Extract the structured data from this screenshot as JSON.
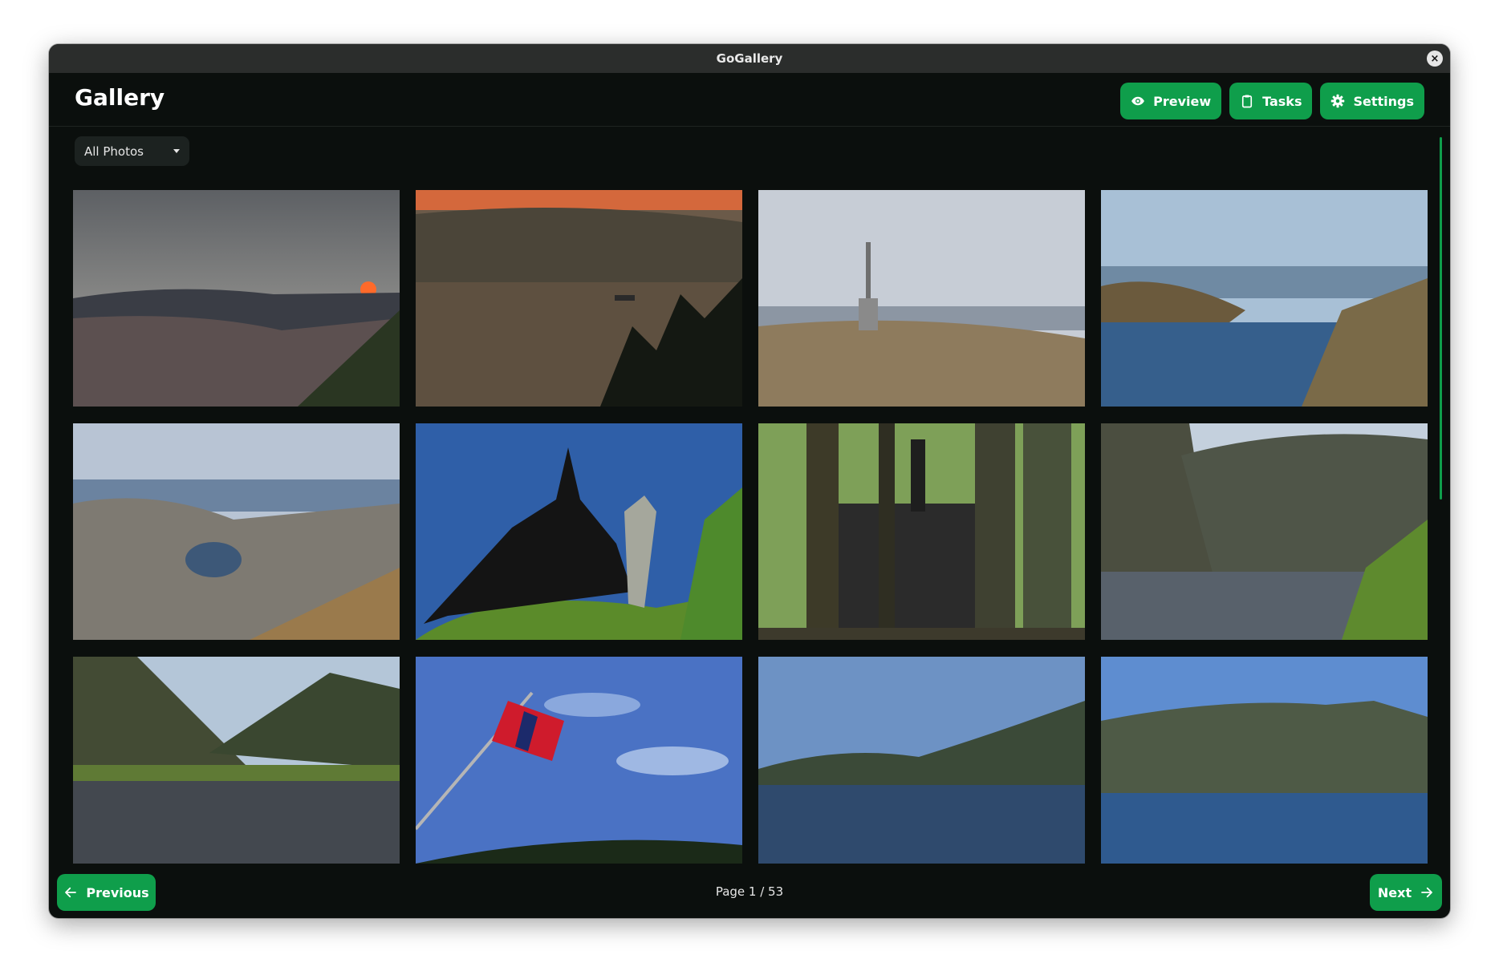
{
  "window": {
    "title": "GoGallery",
    "close_label": "×"
  },
  "header": {
    "title": "Gallery",
    "buttons": {
      "preview_label": "Preview",
      "tasks_label": "Tasks",
      "settings_label": "Settings"
    }
  },
  "filter": {
    "selected": "All Photos"
  },
  "pagination": {
    "previous_label": "Previous",
    "next_label": "Next",
    "page_text": "Page 1 / 53"
  },
  "colors": {
    "accent": "#0f9e4b",
    "background": "#0b0f0d",
    "titlebar": "#2b2d2c"
  },
  "icons": {
    "preview": "eye-icon",
    "tasks": "clipboard-icon",
    "settings": "gear-icon",
    "previous": "arrow-left-icon",
    "next": "arrow-right-icon",
    "dropdown": "chevron-down-icon"
  }
}
